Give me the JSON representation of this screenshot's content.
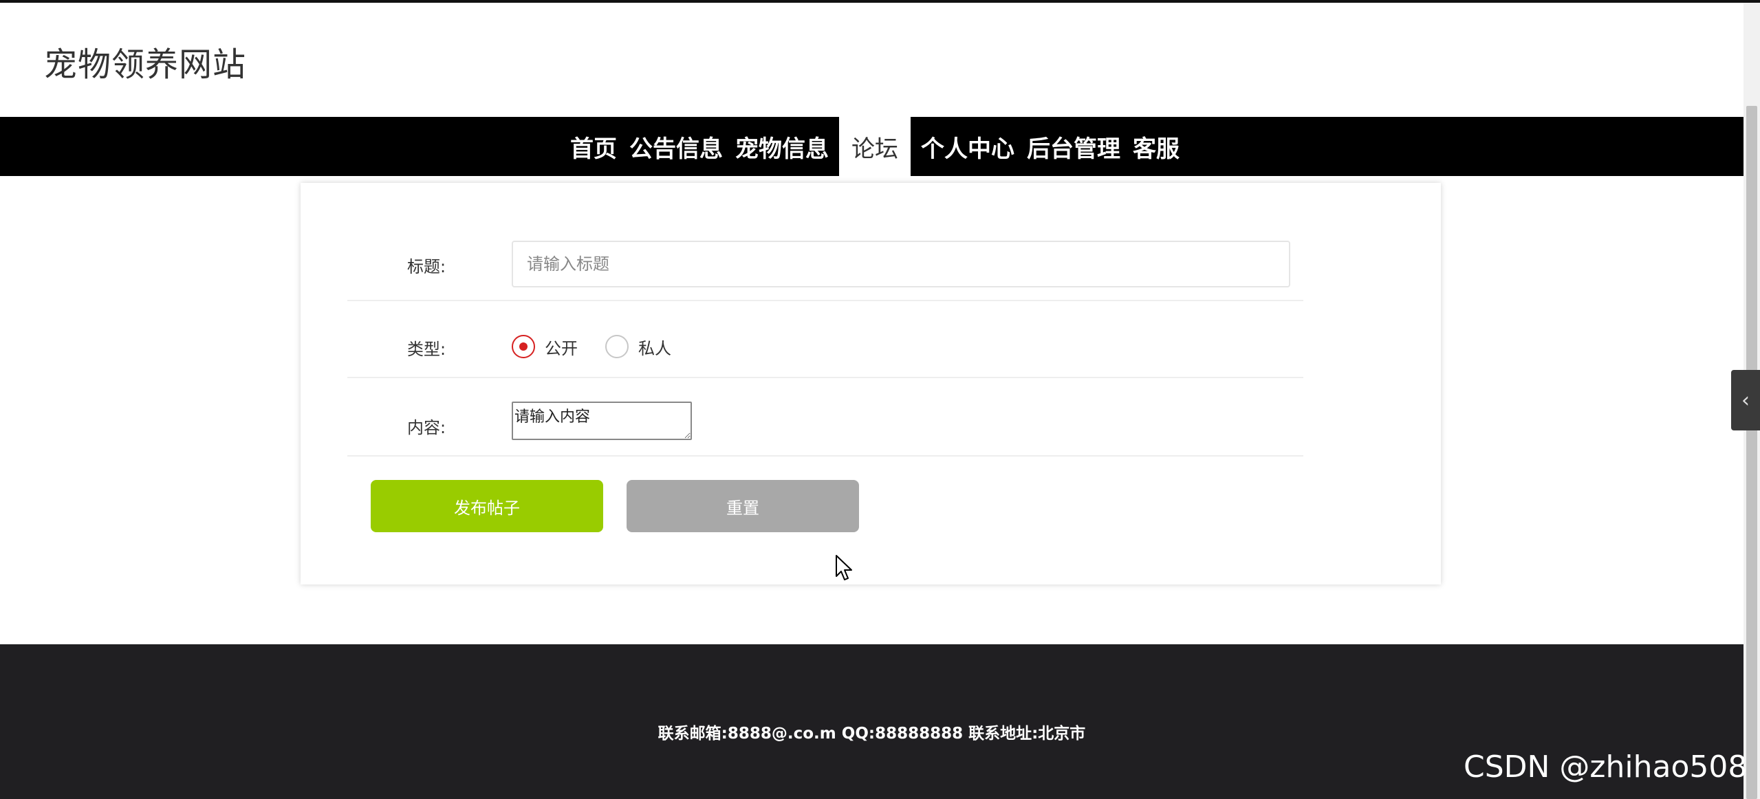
{
  "site": {
    "title": "宠物领养网站"
  },
  "nav": {
    "items": [
      {
        "label": "首页",
        "active": false
      },
      {
        "label": "公告信息",
        "active": false
      },
      {
        "label": "宠物信息",
        "active": false
      },
      {
        "label": "论坛",
        "active": true
      },
      {
        "label": "个人中心",
        "active": false
      },
      {
        "label": "后台管理",
        "active": false
      },
      {
        "label": "客服",
        "active": false
      }
    ]
  },
  "form": {
    "title_label": "标题:",
    "title_placeholder": "请输入标题",
    "type_label": "类型:",
    "type_options": [
      {
        "label": "公开",
        "checked": true
      },
      {
        "label": "私人",
        "checked": false
      }
    ],
    "content_label": "内容:",
    "content_placeholder": "请输入内容",
    "publish_button": "发布帖子",
    "reset_button": "重置"
  },
  "footer": {
    "contact": "联系邮箱:8888@.co.m QQ:88888888 联系地址:北京市"
  },
  "side_tab": {
    "icon": "chevron-left-icon",
    "glyph": "‹"
  },
  "watermark": "CSDN @zhihao508",
  "colors": {
    "nav_bg": "#000000",
    "publish": "#99cc00",
    "reset": "#a8a8a8",
    "radio_checked": "#d62121",
    "footer_bg": "#201f22"
  }
}
